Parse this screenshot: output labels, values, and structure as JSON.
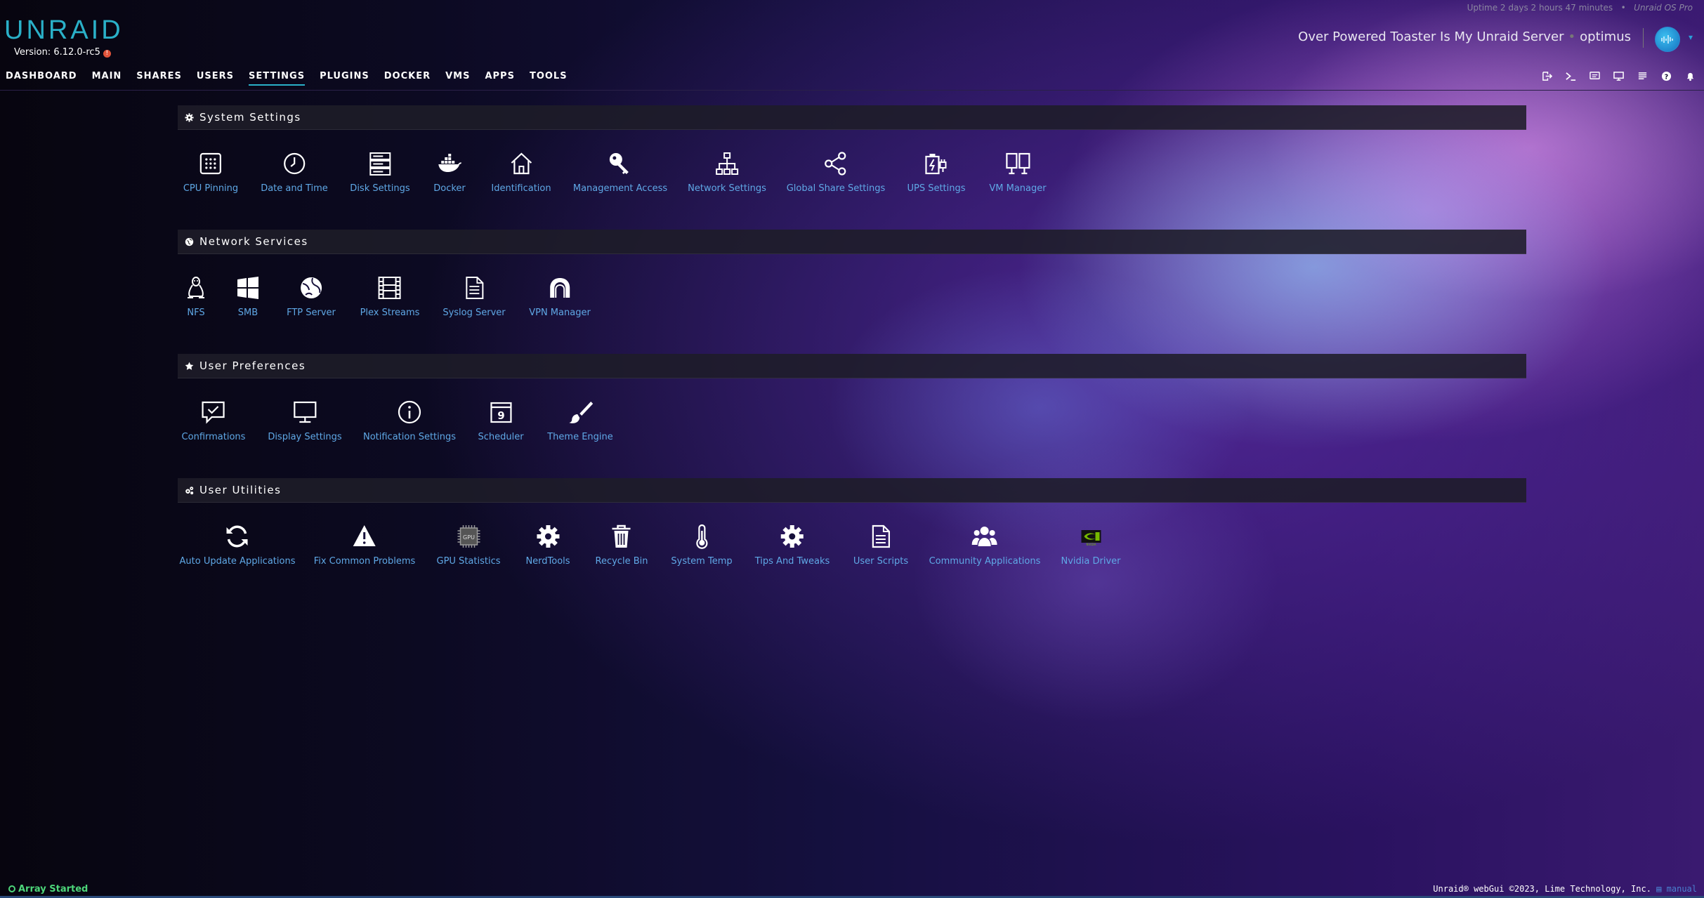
{
  "header": {
    "uptime": "Uptime 2 days 2 hours 47 minutes",
    "edition": "Unraid OS Pro",
    "logo": "UNRAID",
    "version": "Version: 6.12.0-rc5",
    "server_name": "Over Powered Toaster Is My Unraid Server",
    "user": "optimus"
  },
  "nav": {
    "items": [
      "DASHBOARD",
      "MAIN",
      "SHARES",
      "USERS",
      "SETTINGS",
      "PLUGINS",
      "DOCKER",
      "VMS",
      "APPS",
      "TOOLS"
    ],
    "active": "SETTINGS"
  },
  "toolbar": {
    "icons": [
      "logout-icon",
      "terminal-icon",
      "feedback-icon",
      "monitor-icon",
      "log-icon",
      "help-icon",
      "bell-icon"
    ]
  },
  "sections": {
    "system": {
      "title": "System Settings",
      "items": [
        "CPU Pinning",
        "Date and Time",
        "Disk Settings",
        "Docker",
        "Identification",
        "Management Access",
        "Network Settings",
        "Global Share Settings",
        "UPS Settings",
        "VM Manager"
      ]
    },
    "network": {
      "title": "Network Services",
      "items": [
        "NFS",
        "SMB",
        "FTP Server",
        "Plex Streams",
        "Syslog Server",
        "VPN Manager"
      ]
    },
    "prefs": {
      "title": "User Preferences",
      "items": [
        "Confirmations",
        "Display Settings",
        "Notification Settings",
        "Scheduler",
        "Theme Engine"
      ]
    },
    "utilities": {
      "title": "User Utilities",
      "items": [
        "Auto Update Applications",
        "Fix Common Problems",
        "GPU Statistics",
        "NerdTools",
        "Recycle Bin",
        "System Temp",
        "Tips And Tweaks",
        "User Scripts",
        "Community Applications",
        "Nvidia Driver"
      ]
    }
  },
  "footer": {
    "status": "Array Started",
    "copyright": "Unraid® webGui ©2023, Lime Technology, Inc.",
    "manual": "manual"
  },
  "colors": {
    "accent": "#2ab0c8",
    "link": "#5fa8e6",
    "status_ok": "#4dd67a"
  }
}
